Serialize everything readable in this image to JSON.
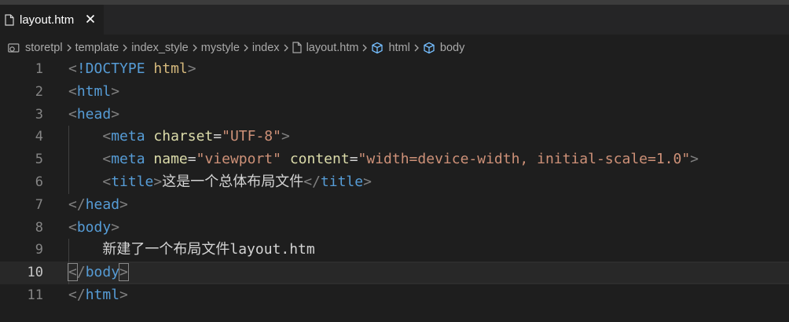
{
  "tab": {
    "label": "layout.htm",
    "close": "✕"
  },
  "breadcrumb": {
    "items": [
      "storetpl",
      "template",
      "index_style",
      "mystyle",
      "index",
      "layout.htm",
      "html",
      "body"
    ],
    "separator": "›"
  },
  "editor": {
    "current_line": 10,
    "lines": [
      {
        "num": "1",
        "tokens": [
          {
            "c": "t",
            "v": "<"
          },
          {
            "c": "n",
            "v": "!DOCTYPE"
          },
          {
            "c": "tx",
            "v": " "
          },
          {
            "c": "dt",
            "v": "html"
          },
          {
            "c": "t",
            "v": ">"
          }
        ]
      },
      {
        "num": "2",
        "tokens": [
          {
            "c": "t",
            "v": "<"
          },
          {
            "c": "n",
            "v": "html"
          },
          {
            "c": "t",
            "v": ">"
          }
        ]
      },
      {
        "num": "3",
        "tokens": [
          {
            "c": "t",
            "v": "<"
          },
          {
            "c": "n",
            "v": "head"
          },
          {
            "c": "t",
            "v": ">"
          }
        ]
      },
      {
        "num": "4",
        "tokens": [
          {
            "c": "tx",
            "v": "    "
          },
          {
            "c": "t",
            "v": "<"
          },
          {
            "c": "n",
            "v": "meta"
          },
          {
            "c": "tx",
            "v": " "
          },
          {
            "c": "a",
            "v": "charset"
          },
          {
            "c": "tx",
            "v": "="
          },
          {
            "c": "s",
            "v": "\"UTF-8\""
          },
          {
            "c": "t",
            "v": ">"
          }
        ]
      },
      {
        "num": "5",
        "tokens": [
          {
            "c": "tx",
            "v": "    "
          },
          {
            "c": "t",
            "v": "<"
          },
          {
            "c": "n",
            "v": "meta"
          },
          {
            "c": "tx",
            "v": " "
          },
          {
            "c": "a",
            "v": "name"
          },
          {
            "c": "tx",
            "v": "="
          },
          {
            "c": "s",
            "v": "\"viewport\""
          },
          {
            "c": "tx",
            "v": " "
          },
          {
            "c": "a",
            "v": "content"
          },
          {
            "c": "tx",
            "v": "="
          },
          {
            "c": "s",
            "v": "\"width=device-width, initial-scale=1.0\""
          },
          {
            "c": "t",
            "v": ">"
          }
        ]
      },
      {
        "num": "6",
        "tokens": [
          {
            "c": "tx",
            "v": "    "
          },
          {
            "c": "t",
            "v": "<"
          },
          {
            "c": "n",
            "v": "title"
          },
          {
            "c": "t",
            "v": ">"
          },
          {
            "c": "tx",
            "v": "这是一个总体布局文件"
          },
          {
            "c": "t",
            "v": "</"
          },
          {
            "c": "n",
            "v": "title"
          },
          {
            "c": "t",
            "v": ">"
          }
        ]
      },
      {
        "num": "7",
        "tokens": [
          {
            "c": "t",
            "v": "</"
          },
          {
            "c": "n",
            "v": "head"
          },
          {
            "c": "t",
            "v": ">"
          }
        ]
      },
      {
        "num": "8",
        "tokens": [
          {
            "c": "t",
            "v": "<"
          },
          {
            "c": "n",
            "v": "body"
          },
          {
            "c": "t",
            "v": ">"
          }
        ]
      },
      {
        "num": "9",
        "tokens": [
          {
            "c": "tx",
            "v": "    "
          },
          {
            "c": "tx",
            "v": "新建了一个布局文件layout.htm"
          }
        ]
      },
      {
        "num": "10",
        "tokens": [
          {
            "c": "t bracket-box",
            "v": "<"
          },
          {
            "c": "t",
            "v": "/"
          },
          {
            "c": "n",
            "v": "body"
          },
          {
            "c": "t bracket-box",
            "v": ">"
          }
        ]
      },
      {
        "num": "11",
        "tokens": [
          {
            "c": "t",
            "v": "</"
          },
          {
            "c": "n",
            "v": "html"
          },
          {
            "c": "t",
            "v": ">"
          }
        ]
      }
    ]
  },
  "colors": {
    "background": "#1e1e1e",
    "tag_bracket": "#808080",
    "tag_name": "#569cd6",
    "attribute": "#dcdcaa",
    "string": "#ce9178",
    "text": "#d4d4d4"
  }
}
